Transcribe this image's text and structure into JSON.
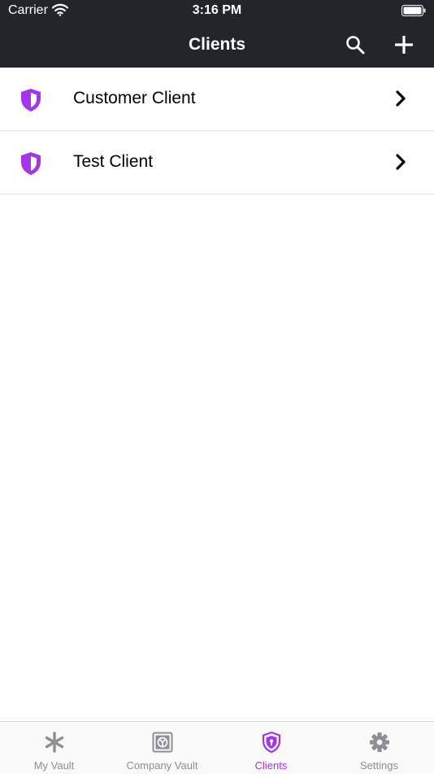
{
  "status_bar": {
    "carrier": "Carrier",
    "time": "3:16 PM"
  },
  "header": {
    "title": "Clients"
  },
  "clients": [
    {
      "name": "Customer Client"
    },
    {
      "name": "Test Client"
    }
  ],
  "tabs": [
    {
      "label": "My Vault",
      "icon": "asterisk-icon"
    },
    {
      "label": "Company Vault",
      "icon": "safe-icon"
    },
    {
      "label": "Clients",
      "icon": "shield-icon",
      "active": true
    },
    {
      "label": "Settings",
      "icon": "gear-icon"
    }
  ],
  "colors": {
    "header_bg": "#22252a",
    "accent": "#a436e8",
    "tab_inactive": "#8e8e93"
  }
}
